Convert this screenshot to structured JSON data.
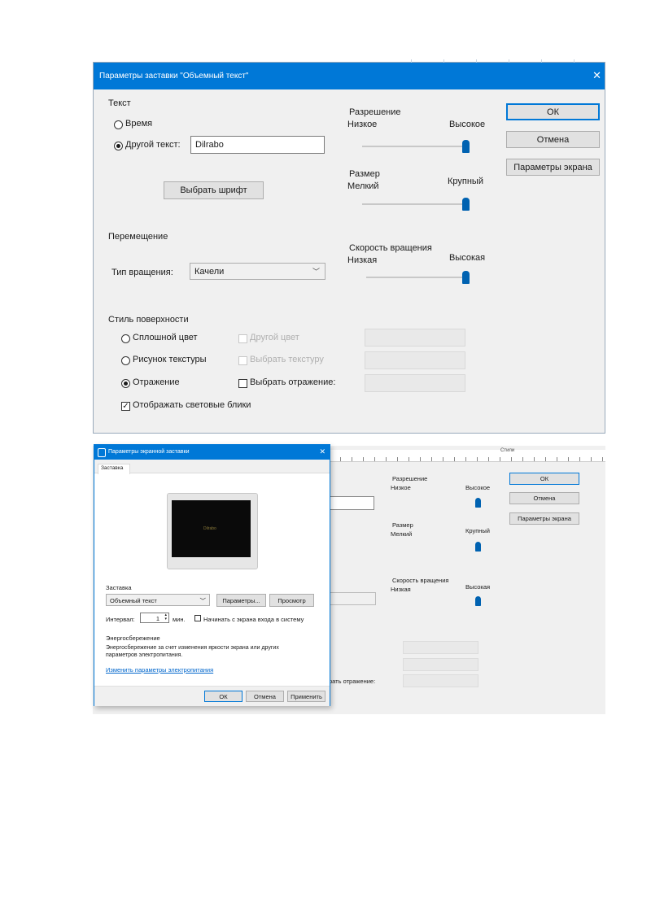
{
  "dialog1": {
    "title": "Параметры заставки \"Объемный текст\"",
    "close": "✕",
    "text_group": "Текст",
    "radio_time": "Время",
    "radio_other": "Другой текст:",
    "text_value": "Dilrabo",
    "choose_font": "Выбрать шрифт",
    "move_group": "Перемещение",
    "rotation_type_label": "Тип вращения:",
    "rotation_type_value": "Качели",
    "surface_group": "Стиль поверхности",
    "solid_color": "Сплошной цвет",
    "texture_picture": "Рисунок текстуры",
    "reflection": "Отражение",
    "highlights": "Отображать световые блики",
    "other_color": "Другой цвет",
    "choose_texture": "Выбрать текстуру",
    "choose_reflection": "Выбрать отражение:",
    "resolution": "Разрешение",
    "res_low": "Низкое",
    "res_high": "Высокое",
    "size": "Размер",
    "size_small": "Мелкий",
    "size_large": "Крупный",
    "speed": "Скорость вращения",
    "speed_low": "Низкая",
    "speed_high": "Высокая",
    "ok": "ОК",
    "cancel": "Отмена",
    "screen_params": "Параметры экрана",
    "slider_resolution_value": 1.0,
    "slider_size_value": 1.0,
    "slider_speed_value": 1.0
  },
  "dialog2": {
    "title": "Параметры экранной заставки",
    "close": "✕",
    "tab": "Заставка",
    "preview_text": "Dilrabo",
    "screensaver_label": "Заставка",
    "screensaver_value": "Объемный текст",
    "params_button": "Параметры...",
    "preview_button": "Просмотр",
    "interval_label": "Интервал:",
    "interval_value": "1",
    "minutes": "мин.",
    "start_login": "Начинать с экрана входа в систему",
    "energy_label": "Энергосбережение",
    "energy_text": "Энергосбережение за счет изменения яркости экрана или других параметров электропитания.",
    "power_link": "Изменить параметры электропитания",
    "ok": "ОК",
    "cancel": "Отмена",
    "apply": "Применить"
  },
  "background_dialog": {
    "resolution": "Разрешение",
    "res_low": "Низкое",
    "res_high": "Высокое",
    "size": "Размер",
    "size_small": "Мелкий",
    "size_large": "Крупный",
    "speed": "Скорость вращения",
    "speed_low": "Низкая",
    "speed_high": "Высокая",
    "ok": "ОК",
    "cancel": "Отмена",
    "screen_params": "Параметры экрана",
    "choose_reflection_partial": "рать отражение:",
    "styles_label": "Стили"
  },
  "colors": {
    "title_bar": "#0078d7",
    "dialog_bg": "#f0f0f0",
    "accent": "#0062b1"
  }
}
